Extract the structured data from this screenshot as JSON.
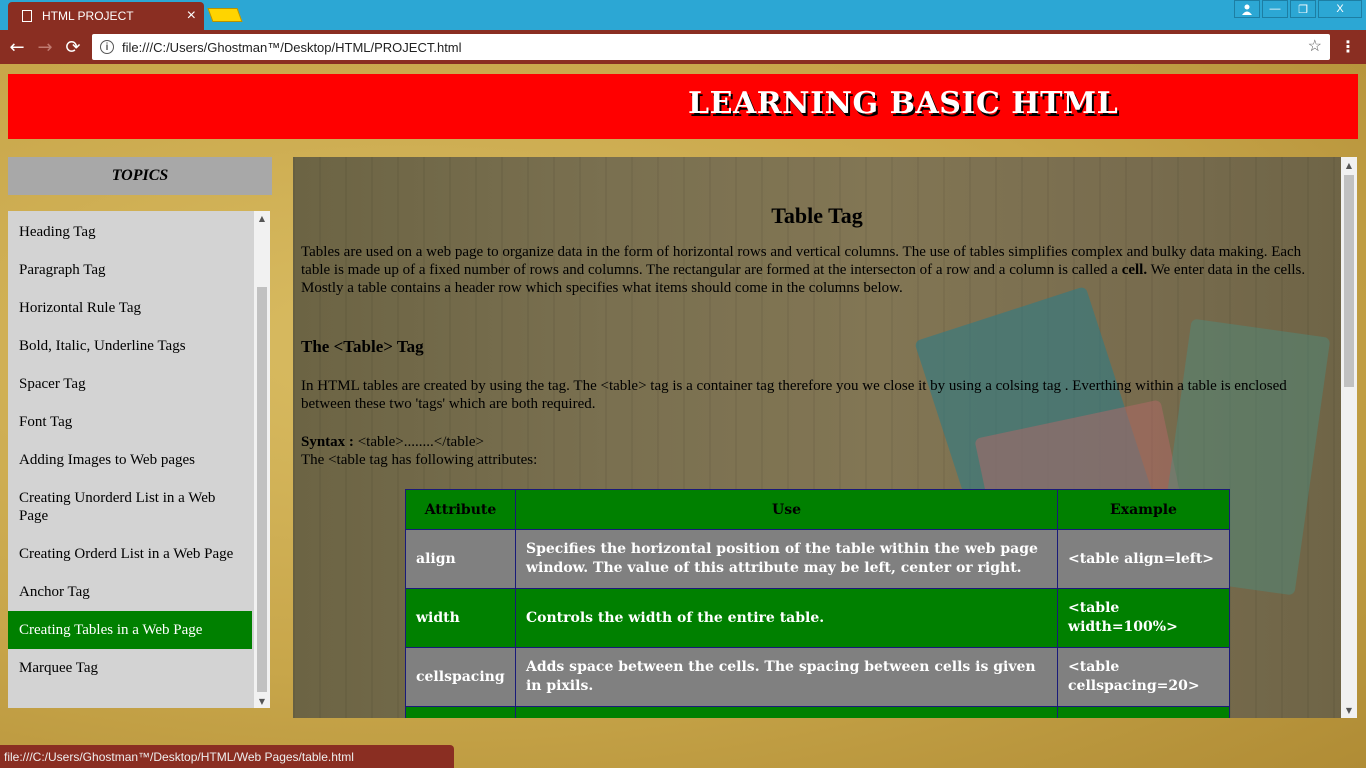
{
  "browser": {
    "tab_title": "HTML PROJECT",
    "tab_close": "×",
    "url": "file:///C:/Users/Ghostman™/Desktop/HTML/PROJECT.html",
    "status_url": "file:///C:/Users/Ghostman™/Desktop/HTML/Web Pages/table.html",
    "window_buttons": {
      "minimize": "—",
      "maximize": "❐",
      "close": "X"
    },
    "nav": {
      "back": "←",
      "forward": "→",
      "reload": "⟳",
      "menu": "⋮",
      "bookmark": "☆",
      "info": "i"
    }
  },
  "banner": {
    "title": "LEARNING BASIC HTML"
  },
  "sidebar": {
    "heading": "TOPICS",
    "items": [
      {
        "label": "Heading Tag"
      },
      {
        "label": "Paragraph Tag"
      },
      {
        "label": "Horizontal Rule Tag"
      },
      {
        "label": "Bold, Italic, Underline Tags"
      },
      {
        "label": "Spacer Tag"
      },
      {
        "label": "Font Tag"
      },
      {
        "label": "Adding Images to Web pages"
      },
      {
        "label": "Creating Unorderd List in a Web Page"
      },
      {
        "label": "Creating Orderd List in a Web Page"
      },
      {
        "label": "Anchor Tag"
      },
      {
        "label": "Creating Tables in a Web Page",
        "active": true
      },
      {
        "label": "Marquee Tag"
      }
    ]
  },
  "content": {
    "title": "Table Tag",
    "intro_before": "Tables are used on a web page to organize data in the form of horizontal rows and vertical columns. The use of tables simplifies complex and bulky data making. Each table is made up of a fixed number of rows and columns. The rectangular are formed at the intersecton of a row and a column is called a ",
    "intro_bold": "cell.",
    "intro_after": " We enter data in the cells. Mostly a table contains a header row which specifies what items should come in the columns below.",
    "section_title": "The <Table> Tag",
    "section_text": "In HTML tables are created by using the tag. The <table> tag is a container tag therefore you we close it by using a colsing tag . Everthing within a table is enclosed between these two 'tags' which are both required.",
    "syntax_label": "Syntax :",
    "syntax_value": " <table>........</table>",
    "attributes_line": "The <table tag has following attributes:",
    "table": {
      "headers": [
        "Attribute",
        "Use",
        "Example"
      ],
      "rows": [
        [
          "align",
          "Specifies the horizontal position of the table within the web page window. The value of this attribute may be left, center or right.",
          "<table align=left>"
        ],
        [
          "width",
          "Controls the width of the entire table.",
          "<table width=100%>"
        ],
        [
          "cellspacing",
          "Adds space between the cells. The spacing between cells is given in pixils.",
          "<table cellspacing=20>"
        ],
        [
          "",
          "",
          ""
        ]
      ]
    }
  }
}
